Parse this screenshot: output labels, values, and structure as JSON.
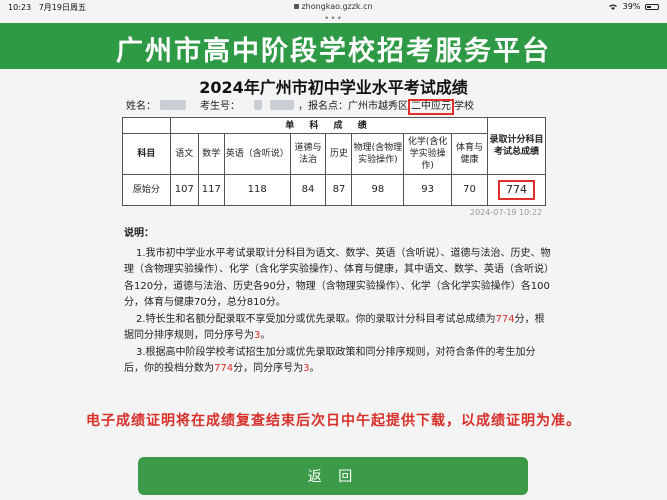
{
  "status_bar": {
    "time": "10:23",
    "date": "7月19日周五",
    "url": "zhongkao.gzzk.cn",
    "battery": "39%",
    "battery_fraction": 0.39,
    "dots": "•••"
  },
  "banner": {
    "title": "广州市高中阶段学校招考服务平台"
  },
  "result": {
    "title": "2024年广州市初中学业水平考试成绩",
    "name_label": "姓名：",
    "exam_no_label": "考生号：",
    "separator": "，",
    "site_label": "报名点：",
    "site_prefix": "广州市越秀区",
    "site_box": "二中应元",
    "site_suffix": "学校"
  },
  "table": {
    "subject_group_header": "单 科 成 绩",
    "total_header": "录取计分科目考试总成绩",
    "columns": [
      "科目",
      "语文",
      "数学",
      "英语（含听说）",
      "道德与法治",
      "历史",
      "物理(含物理实验操作)",
      "化学(含化学实验操作)",
      "体育与健康"
    ],
    "row_label": "原始分",
    "scores": [
      "107",
      "117",
      "118",
      "84",
      "87",
      "98",
      "93",
      "70"
    ],
    "total": "774"
  },
  "timestamp": "2024-07-19 10:22",
  "notes": {
    "heading": "说明：",
    "item1": "1.我市初中学业水平考试录取计分科目为语文、数学、英语（含听说）、道德与法治、历史、物理（含物理实验操作）、化学（含化学实验操作）、体育与健康，其中语文、数学、英语（含听说）各120分，道德与法治、历史各90分，物理（含物理实验操作）、化学（含化学实验操作）各100分，体育与健康70分，总分810分。",
    "item2_a": "2.特长生和名额分配录取不享受加分或优先录取。你的录取计分科目考试总成绩为",
    "item2_score": "774",
    "item2_b": "分，根据同分排序规则，同分序号为",
    "item2_rank": "3",
    "item2_c": "。",
    "item3_a": "3.根据高中阶段学校考试招生加分或优先录取政策和同分排序规则，对符合条件的考生加分后，你的投档分数为",
    "item3_score": "774",
    "item3_b": "分，同分序号为",
    "item3_rank": "3",
    "item3_c": "。"
  },
  "notice": "电子成绩证明将在成绩复查结束后次日中午起提供下载，以成绩证明为准。",
  "back_button": "返 回"
}
